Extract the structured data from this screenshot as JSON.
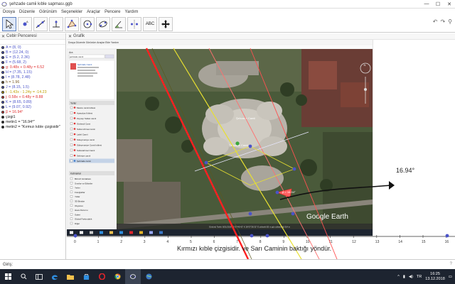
{
  "window": {
    "title": "şehzade camii kıble sapması.ggb",
    "minimize": "—",
    "maximize": "☐",
    "close": "✕"
  },
  "menu": [
    "Dosya",
    "Düzenle",
    "Görünüm",
    "Seçenekler",
    "Araçlar",
    "Pencere",
    "Yardım"
  ],
  "toolbar": {
    "tools": [
      "move",
      "point",
      "line",
      "perpendicular",
      "polygon",
      "circle",
      "conic",
      "angle",
      "reflect",
      "text",
      "move-view"
    ],
    "text_tool_label": "ABC",
    "active": 0,
    "undo": "↶",
    "redo": "↷",
    "search": "⚲"
  },
  "algebra": {
    "header": "Cebir Penceresi",
    "items": [
      {
        "text": "A = (8, 0)",
        "color": "#4a53c9"
      },
      {
        "text": "B = (12.24, 0)",
        "color": "#4a53c9"
      },
      {
        "text": "E = (5.2, 2.36)",
        "color": "#4a53c9"
      },
      {
        "text": "F = (5.68, 2)",
        "color": "#4a53c9"
      },
      {
        "text": "g: 0.48x + 0.48y = 6.52",
        "color": "#e03030"
      },
      {
        "text": "H = (7.35, 1.15)",
        "color": "#4a53c9"
      },
      {
        "text": "I = (8.78, 2.48)",
        "color": "#4a53c9"
      },
      {
        "text": "h = 1.96",
        "color": "#7a5a2a"
      },
      {
        "text": "J = (8.15, 1.5)",
        "color": "#4a53c9"
      },
      {
        "text": "i: -1.43x - 1.24y = -14.23",
        "color": "#c0a000"
      },
      {
        "text": "j: 0.58x + 0.48y = 8.88",
        "color": "#e03030"
      },
      {
        "text": "K = (8.65, 0.89)",
        "color": "#4a53c9"
      },
      {
        "text": "L = (9.07, 0.92)",
        "color": "#4a53c9"
      },
      {
        "text": "β = 16.94°",
        "color": "#e03030"
      },
      {
        "text": "çizgi1",
        "color": "#222222"
      },
      {
        "text": "metin1 = \"16.94°\"",
        "color": "#222222"
      },
      {
        "text": "metin2 = \"Kırmızı kıble çizgisidir\"",
        "color": "#222222"
      }
    ]
  },
  "graphics": {
    "header": "Grafik",
    "angle_label": "16.94°",
    "point_labels": {
      "beta_on_map": "β = 16.94°"
    },
    "caption": "Kırmızı kıble çizgisidir. ve Sarı Caminin baktığı yöndür.",
    "x_ticks": [
      "0",
      "1",
      "2",
      "3",
      "4",
      "5",
      "6",
      "7",
      "8",
      "9",
      "10",
      "11",
      "12",
      "13",
      "14",
      "15",
      "16"
    ],
    "map": {
      "menu": [
        "Dosya",
        "Düzenle",
        "Görünüm",
        "Araçlar",
        "Ekle",
        "Yardım"
      ],
      "search_label": "Ara",
      "search_value": "şehzade camii",
      "result_title": "Şehzade Camii",
      "places_header": "Yerler",
      "places": [
        "Mesire camii kıblesi",
        "Ayasofya Kıblesi",
        "Zeynep Sultan camii",
        "Gürbeyli Cami",
        "Sultan Ahmet camii",
        "Laleli Camii",
        "Süleymaniye camii",
        "Süleymaniye Camii kıblesi",
        "Sultanahmet Camii",
        "Selimiye camii",
        "Şehzade camii"
      ],
      "layers_header": "Katmanlar",
      "layers": [
        "Birincil Veritabanı",
        "Sınırlar ve Etiketler",
        "Yerler",
        "Fotoğraflar",
        "Yollar",
        "3D Binalar",
        "Okyanus",
        "Hava Durumu",
        "Galeri",
        "Global Farkındalık",
        "Diğer"
      ],
      "brand": "Google Earth",
      "label_sehzade": "Şehzade Camii",
      "label_camii": "Şehzade Camii",
      "label_beta": "β = 16.94°",
      "status": "Görüntü Tarihi: 8/21/2016   41°00'49.42\" K  28°57'28.32\" D  yükselti 55 m   göz yüksekliği 314 m"
    }
  },
  "inputbar": {
    "label": "Giriş:",
    "placeholder": ""
  },
  "taskbar": {
    "tray_lang": "TR",
    "time": "16:25",
    "date": "13.12.2018"
  },
  "colors": {
    "qibla_line": "#ff2020",
    "mosque_line": "#e8e030",
    "accent": "#5b7fbf",
    "point": "#4a53c9"
  }
}
